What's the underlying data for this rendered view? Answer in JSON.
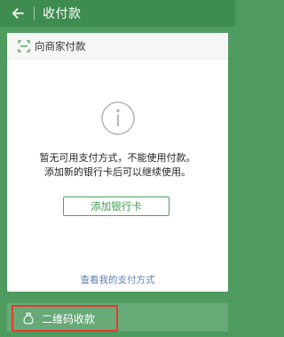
{
  "header": {
    "back_icon": "arrow-left-icon",
    "title": "收付款"
  },
  "card": {
    "header_icon": "scan-icon",
    "header_label": "向商家付款",
    "status_icon": "info-circle-icon",
    "message_line1": "暂无可用支付方式，不能使用付款。",
    "message_line2": "添加新的银行卡后可以继续使用。",
    "add_card_label": "添加银行卡",
    "view_methods_label": "查看我的支付方式"
  },
  "bottom": {
    "icon": "money-bag-icon",
    "label": "二维码收款",
    "highlight_color": "#e33b2e"
  },
  "colors": {
    "background": "#4f9a5f",
    "accent": "#3d9c52",
    "link": "#5a7fb8"
  }
}
